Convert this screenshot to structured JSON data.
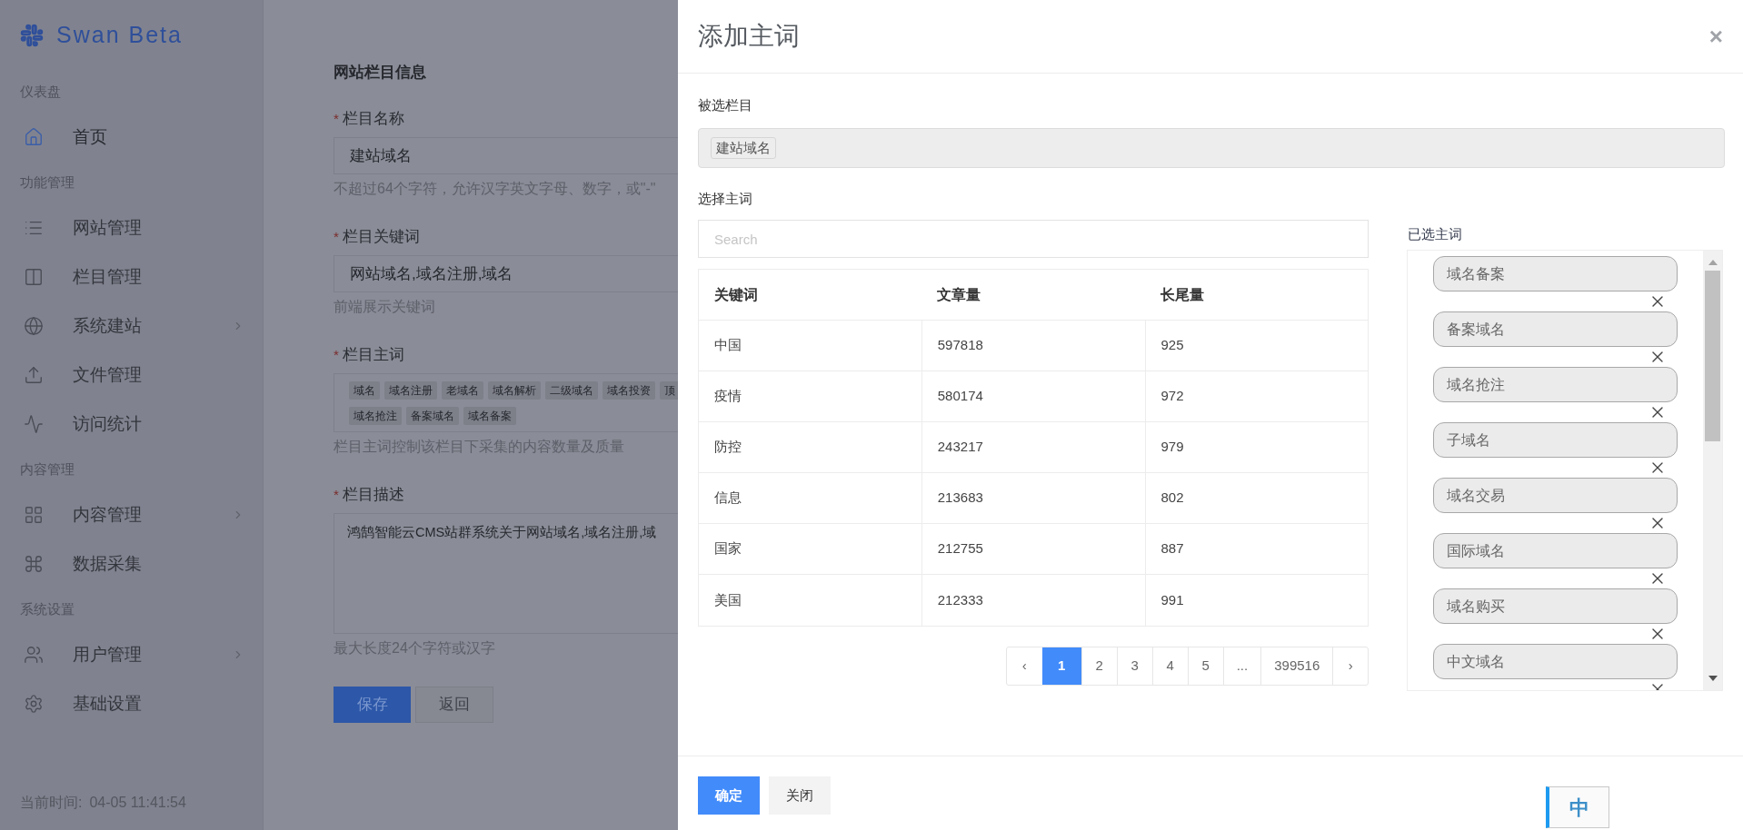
{
  "sidebar": {
    "brand": "Swan Beta",
    "sections": [
      {
        "title": "仪表盘",
        "items": [
          {
            "label": "首页",
            "selected": true,
            "expandable": false
          }
        ]
      },
      {
        "title": "功能管理",
        "items": [
          {
            "label": "网站管理",
            "selected": false,
            "expandable": false
          },
          {
            "label": "栏目管理",
            "selected": false,
            "expandable": false
          },
          {
            "label": "系统建站",
            "selected": false,
            "expandable": true
          },
          {
            "label": "文件管理",
            "selected": false,
            "expandable": false
          },
          {
            "label": "访问统计",
            "selected": false,
            "expandable": false
          }
        ]
      },
      {
        "title": "内容管理",
        "items": [
          {
            "label": "内容管理",
            "selected": false,
            "expandable": true
          },
          {
            "label": "数据采集",
            "selected": false,
            "expandable": false
          }
        ]
      },
      {
        "title": "系统设置",
        "items": [
          {
            "label": "用户管理",
            "selected": false,
            "expandable": true
          },
          {
            "label": "基础设置",
            "selected": false,
            "expandable": false
          }
        ]
      }
    ],
    "time_label": "当前时间:",
    "time": "04-05 11:41:54"
  },
  "form": {
    "section_title": "网站栏目信息",
    "fields": [
      {
        "kind": "input",
        "marker": "*",
        "label": "栏目名称",
        "value": "建站域名",
        "hint": "不超过64个字符，允许汉字英文字母、数字，或\"-\""
      },
      {
        "kind": "input",
        "marker": "*",
        "label": "栏目关键词",
        "value": "网站域名,域名注册,域名",
        "hint": "前端展示关键词"
      },
      {
        "kind": "tags",
        "marker": "*",
        "label": "栏目主词",
        "tag_rows": [
          [
            "域名",
            "域名注册",
            "老域名",
            "域名解析",
            "二级域名",
            "域名投资",
            "顶"
          ],
          [
            "域名抢注",
            "备案域名",
            "域名备案"
          ]
        ],
        "hint": "栏目主词控制该栏目下采集的内容数量及质量"
      },
      {
        "kind": "textarea",
        "marker": "*",
        "label": "栏目描述",
        "value": "鸿鹄智能云CMS站群系统关于网站域名,域名注册,域",
        "hint": "最大长度24个字符或汉字"
      }
    ],
    "buttons": [
      "保存",
      "返回"
    ]
  },
  "modal": {
    "title": "添加主词",
    "close": "×",
    "selected_column_label": "被选栏目",
    "selected_column_tag": "建站域名",
    "choose_label": "选择主词",
    "search": {
      "placeholder": "Search"
    },
    "table": {
      "columns": [
        "关键词",
        "文章量",
        "长尾量"
      ],
      "rows": [
        [
          "中国",
          "597818",
          "925"
        ],
        [
          "疫情",
          "580174",
          "972"
        ],
        [
          "防控",
          "243217",
          "979"
        ],
        [
          "信息",
          "213683",
          "802"
        ],
        [
          "国家",
          "212755",
          "887"
        ],
        [
          "美国",
          "212333",
          "991"
        ]
      ]
    },
    "pagination": [
      {
        "label": "‹",
        "selected": false
      },
      {
        "label": "1",
        "selected": true
      },
      {
        "label": "2",
        "selected": false
      },
      {
        "label": "3",
        "selected": false
      },
      {
        "label": "4",
        "selected": false
      },
      {
        "label": "5",
        "selected": false
      },
      {
        "label": "...",
        "selected": false
      },
      {
        "label": "399516",
        "selected": false
      },
      {
        "label": "›",
        "selected": false
      }
    ],
    "chosen_label": "已选主词",
    "chosen": [
      "域名备案",
      "备案域名",
      "域名抢注",
      "子域名",
      "域名交易",
      "国际域名",
      "域名购买",
      "中文域名"
    ],
    "buttons": [
      "确定",
      "关闭"
    ]
  },
  "ime_indicator": "中"
}
